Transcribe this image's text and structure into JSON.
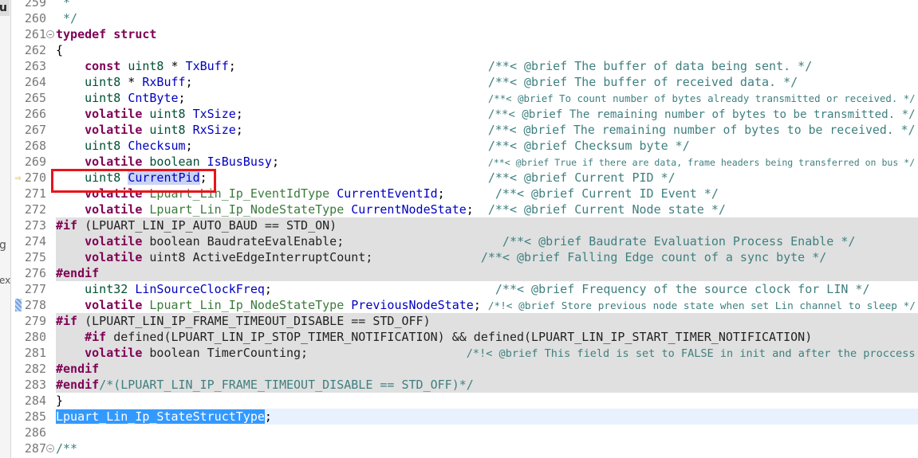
{
  "left_panel": {
    "fragments": [
      "u",
      "g",
      "ex"
    ]
  },
  "editor": {
    "colors": {
      "keyword": "#7f0055",
      "comment": "#3f7f7f",
      "field": "#0000c0",
      "type": "#005032",
      "inactive_bg": "#e0e0e0",
      "selection": "#3399ff",
      "annotation_box": "#e8141b"
    },
    "lines": [
      {
        "num": "259",
        "tokens": [
          [
            "cm",
            " *"
          ]
        ]
      },
      {
        "num": "260",
        "tokens": [
          [
            "cm",
            " */"
          ]
        ]
      },
      {
        "num": "261",
        "fold": true,
        "tokens": [
          [
            "kw",
            "typedef"
          ],
          [
            "pl",
            " "
          ],
          [
            "kw",
            "struct"
          ]
        ]
      },
      {
        "num": "262",
        "tokens": [
          [
            "pl",
            "{"
          ]
        ]
      },
      {
        "num": "263",
        "tokens": [
          [
            "pl",
            "    "
          ],
          [
            "kw",
            "const"
          ],
          [
            "pl",
            " "
          ],
          [
            "ty",
            "uint8"
          ],
          [
            "pl",
            " * "
          ],
          [
            "fd",
            "TxBuff"
          ],
          [
            "pl",
            ";                                   "
          ],
          [
            "cm",
            "/**< @brief The buffer of data being sent. */"
          ]
        ]
      },
      {
        "num": "264",
        "tokens": [
          [
            "pl",
            "    "
          ],
          [
            "ty",
            "uint8"
          ],
          [
            "pl",
            " * "
          ],
          [
            "fd",
            "RxBuff"
          ],
          [
            "pl",
            ";                                         "
          ],
          [
            "cm",
            "/**< @brief The buffer of received data. */"
          ]
        ]
      },
      {
        "num": "265",
        "tokens": [
          [
            "pl",
            "    "
          ],
          [
            "ty",
            "uint8"
          ],
          [
            "pl",
            " "
          ],
          [
            "fd",
            "CntByte"
          ],
          [
            "pl",
            ";                                          "
          ],
          [
            "cm",
            "/**< @brief To count number of bytes already transmitted or received. */"
          ]
        ]
      },
      {
        "num": "266",
        "tokens": [
          [
            "pl",
            "    "
          ],
          [
            "kw",
            "volatile"
          ],
          [
            "pl",
            " "
          ],
          [
            "ty",
            "uint8"
          ],
          [
            "pl",
            " "
          ],
          [
            "fd",
            "TxSize"
          ],
          [
            "pl",
            ";                                  "
          ],
          [
            "cm",
            "/**< @brief The remaining number of bytes to be transmitted. */"
          ]
        ]
      },
      {
        "num": "267",
        "tokens": [
          [
            "pl",
            "    "
          ],
          [
            "kw",
            "volatile"
          ],
          [
            "pl",
            " "
          ],
          [
            "ty",
            "uint8"
          ],
          [
            "pl",
            " "
          ],
          [
            "fd",
            "RxSize"
          ],
          [
            "pl",
            ";                                  "
          ],
          [
            "cm",
            "/**< @brief The remaining number of bytes to be received. */"
          ]
        ]
      },
      {
        "num": "268",
        "tokens": [
          [
            "pl",
            "    "
          ],
          [
            "ty",
            "uint8"
          ],
          [
            "pl",
            " "
          ],
          [
            "fd",
            "Checksum"
          ],
          [
            "pl",
            ";                                         "
          ],
          [
            "cm",
            "/**< @brief Checksum byte */"
          ]
        ]
      },
      {
        "num": "269",
        "tokens": [
          [
            "pl",
            "    "
          ],
          [
            "kw",
            "volatile"
          ],
          [
            "pl",
            " "
          ],
          [
            "ty",
            "boolean"
          ],
          [
            "pl",
            " "
          ],
          [
            "fd",
            "IsBusBusy"
          ],
          [
            "pl",
            ";                             "
          ],
          [
            "cm",
            "/**< @brief True if there are data, frame headers being transferred on bus */"
          ]
        ]
      },
      {
        "num": "270",
        "arrow": true,
        "tokens": [
          [
            "pl",
            "    "
          ],
          [
            "ty",
            "uint8"
          ],
          [
            "pl",
            " "
          ],
          [
            "fd occ",
            "CurrentPid"
          ],
          [
            "pl",
            ";                                       "
          ],
          [
            "cm",
            "/**< @brief Current PID */"
          ]
        ]
      },
      {
        "num": "271",
        "tokens": [
          [
            "pl",
            "    "
          ],
          [
            "kw",
            "volatile"
          ],
          [
            "pl",
            " "
          ],
          [
            "td",
            "Lpuart_Lin_Ip_EventIdType"
          ],
          [
            "pl",
            " "
          ],
          [
            "fd",
            "CurrentEventId"
          ],
          [
            "pl",
            ";       "
          ],
          [
            "cm",
            "/**< @brief Current ID Event */"
          ]
        ]
      },
      {
        "num": "272",
        "tokens": [
          [
            "pl",
            "    "
          ],
          [
            "kw",
            "volatile"
          ],
          [
            "pl",
            " "
          ],
          [
            "td",
            "Lpuart_Lin_Ip_NodeStateType"
          ],
          [
            "pl",
            " "
          ],
          [
            "fd",
            "CurrentNodeState"
          ],
          [
            "pl",
            ";  "
          ],
          [
            "cm",
            "/**< @brief Current Node state */"
          ]
        ]
      },
      {
        "num": "273",
        "inactive": true,
        "tokens": [
          [
            "pp",
            "#if"
          ],
          [
            "mc",
            " (LPUART_LIN_IP_AUTO_BAUD == STD_ON)"
          ]
        ]
      },
      {
        "num": "274",
        "inactive": true,
        "tokens": [
          [
            "mc",
            "    "
          ],
          [
            "kw",
            "volatile"
          ],
          [
            "mc",
            " boolean BaudrateEvalEnable;                      "
          ],
          [
            "cm",
            "/**< @brief Baudrate Evaluation Process Enable */"
          ]
        ]
      },
      {
        "num": "275",
        "inactive": true,
        "tokens": [
          [
            "mc",
            "    "
          ],
          [
            "kw",
            "volatile"
          ],
          [
            "mc",
            " uint8 ActiveEdgeInterruptCount;               "
          ],
          [
            "cm",
            "/**< @brief Falling Edge count of a sync byte */"
          ]
        ]
      },
      {
        "num": "276",
        "inactive": true,
        "tokens": [
          [
            "pp",
            "#endif"
          ]
        ]
      },
      {
        "num": "277",
        "tokens": [
          [
            "pl",
            "    "
          ],
          [
            "ty",
            "uint32"
          ],
          [
            "pl",
            " "
          ],
          [
            "fd",
            "LinSourceClockFreq"
          ],
          [
            "pl",
            ";                               "
          ],
          [
            "cm",
            "/**< @brief Frequency of the source clock for LIN */"
          ]
        ]
      },
      {
        "num": "278",
        "marker": true,
        "tokens": [
          [
            "pl",
            "    "
          ],
          [
            "kw",
            "volatile"
          ],
          [
            "pl",
            " "
          ],
          [
            "td",
            "Lpuart_Lin_Ip_NodeStateType"
          ],
          [
            "pl",
            " "
          ],
          [
            "fd",
            "PreviousNodeState"
          ],
          [
            "pl",
            "; "
          ],
          [
            "cm",
            "/*!< @brief Store previous node state when set Lin channel to sleep */"
          ]
        ]
      },
      {
        "num": "279",
        "inactive": true,
        "tokens": [
          [
            "pp",
            "#if"
          ],
          [
            "mc",
            " (LPUART_LIN_IP_FRAME_TIMEOUT_DISABLE == STD_OFF)"
          ]
        ]
      },
      {
        "num": "280",
        "inactive": true,
        "tokens": [
          [
            "mc",
            "    "
          ],
          [
            "pp",
            "#if"
          ],
          [
            "mc",
            " defined(LPUART_LIN_IP_STOP_TIMER_NOTIFICATION) && defined(LPUART_LIN_IP_START_TIMER_NOTIFICATION)"
          ]
        ]
      },
      {
        "num": "281",
        "inactive": true,
        "tokens": [
          [
            "mc",
            "    "
          ],
          [
            "kw",
            "volatile"
          ],
          [
            "mc",
            " boolean TimerCounting;                      "
          ],
          [
            "cm",
            "/*!< @brief This field is set to FALSE in init and after the proccess"
          ]
        ]
      },
      {
        "num": "282",
        "inactive": true,
        "tokens": [
          [
            "pp",
            "#endif"
          ]
        ]
      },
      {
        "num": "283",
        "inactive": true,
        "tokens": [
          [
            "pp",
            "#endif"
          ],
          [
            "cm",
            "/*(LPUART_LIN_IP_FRAME_TIMEOUT_DISABLE == STD_OFF)*/"
          ]
        ]
      },
      {
        "num": "284",
        "tokens": [
          [
            "pl",
            "}"
          ]
        ]
      },
      {
        "num": "285",
        "current": true,
        "tokens": [
          [
            "sel",
            "Lpuart_Lin_Ip_StateStructType"
          ],
          [
            "pl",
            ";"
          ]
        ]
      },
      {
        "num": "286",
        "tokens": []
      },
      {
        "num": "287",
        "fold": true,
        "tokens": [
          [
            "cm",
            "/**"
          ]
        ]
      }
    ]
  }
}
